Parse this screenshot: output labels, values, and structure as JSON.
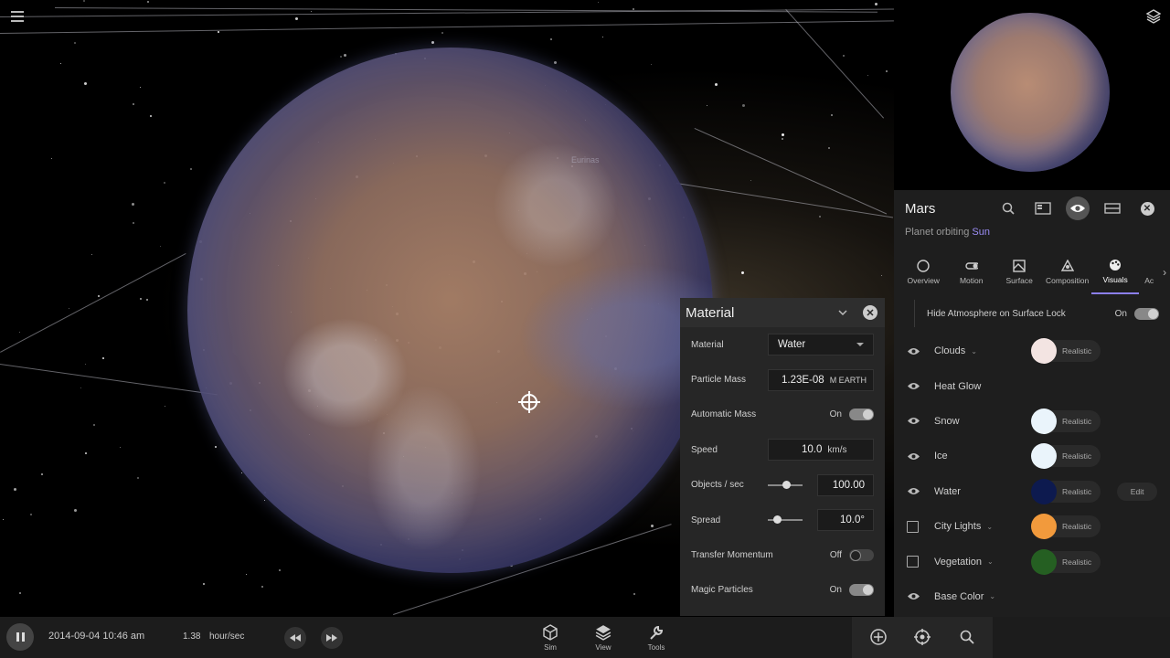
{
  "viewport": {
    "planet_label": "Eurinas"
  },
  "material_panel": {
    "title": "Material",
    "rows": {
      "material_label": "Material",
      "material_value": "Water",
      "particle_mass_label": "Particle Mass",
      "particle_mass_value": "1.23E-08",
      "particle_mass_unit": "M EARTH",
      "automatic_mass_label": "Automatic Mass",
      "automatic_mass_state": "On",
      "speed_label": "Speed",
      "speed_value": "10.0",
      "speed_unit": "km/s",
      "objects_label": "Objects / sec",
      "objects_value": "100.00",
      "spread_label": "Spread",
      "spread_value": "10.0°",
      "transfer_label": "Transfer Momentum",
      "transfer_state": "Off",
      "magic_label": "Magic Particles",
      "magic_state": "On"
    }
  },
  "object_panel": {
    "name": "Mars",
    "subtitle_prefix": "Planet orbiting",
    "subtitle_link": "Sun",
    "tabs": [
      {
        "label": "Overview",
        "icon": "circle-icon"
      },
      {
        "label": "Motion",
        "icon": "motion-icon"
      },
      {
        "label": "Surface",
        "icon": "surface-icon"
      },
      {
        "label": "Composition",
        "icon": "composition-icon"
      },
      {
        "label": "Visuals",
        "icon": "palette-icon",
        "active": true
      },
      {
        "label": "Ac",
        "icon": "more-icon"
      }
    ],
    "atmosphere_label": "Hide Atmosphere on Surface Lock",
    "atmosphere_state": "On",
    "visual_rows": [
      {
        "label": "Clouds",
        "control": "eye",
        "dropdown": true,
        "color": "#f3e4e2",
        "mode": "Realistic"
      },
      {
        "label": "Heat Glow",
        "control": "eye",
        "dropdown": false
      },
      {
        "label": "Snow",
        "control": "eye",
        "dropdown": false,
        "color": "#eaf4fb",
        "mode": "Realistic"
      },
      {
        "label": "Ice",
        "control": "eye",
        "dropdown": false,
        "color": "#eaf4fb",
        "mode": "Realistic"
      },
      {
        "label": "Water",
        "control": "eye",
        "dropdown": false,
        "color": "#0d1a4f",
        "mode": "Realistic",
        "edit": "Edit"
      },
      {
        "label": "City Lights",
        "control": "checkbox",
        "dropdown": true,
        "color": "#f29a3c",
        "mode": "Realistic"
      },
      {
        "label": "Vegetation",
        "control": "checkbox",
        "dropdown": true,
        "color": "#255f22",
        "mode": "Realistic"
      },
      {
        "label": "Base Color",
        "control": "eye",
        "dropdown": true
      }
    ]
  },
  "bottom_bar": {
    "datetime": "2014-09-04 10:46 am",
    "rate_value": "1.38",
    "rate_unit": "hour/sec",
    "nav": [
      {
        "label": "Sim",
        "icon": "cube-icon"
      },
      {
        "label": "View",
        "icon": "layers-icon"
      },
      {
        "label": "Tools",
        "icon": "wrench-icon"
      }
    ]
  }
}
